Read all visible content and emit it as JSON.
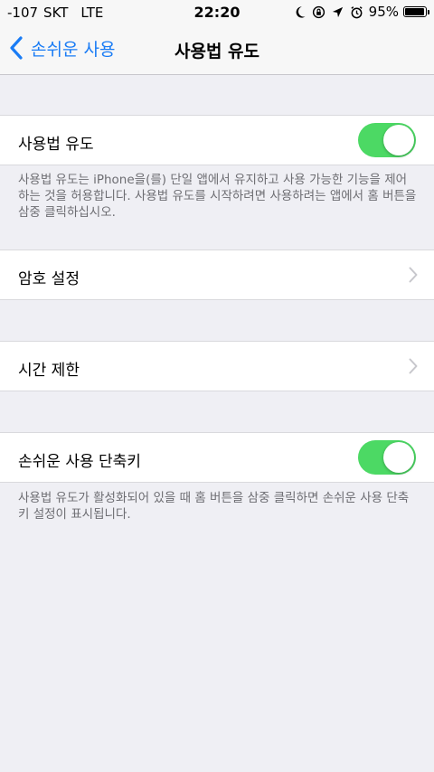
{
  "status_bar": {
    "signal": "-107",
    "carrier": "SKT",
    "network": "LTE",
    "time": "22:20",
    "battery_percent": "95%",
    "icons": [
      "moon-icon",
      "rotation-lock-icon",
      "location-arrow-icon",
      "alarm-icon",
      "battery-icon"
    ]
  },
  "nav": {
    "back_label": "손쉬운 사용",
    "title": "사용법 유도"
  },
  "sections": {
    "guided_access": {
      "label": "사용법 유도",
      "enabled": true,
      "footer": "사용법 유도는 iPhone을(를) 단일 앱에서 유지하고 사용 가능한 기능을 제어하는 것을 허용합니다. 사용법 유도를 시작하려면 사용하려는 앱에서 홈 버튼을 삼중 클릭하십시오."
    },
    "passcode": {
      "label": "암호 설정"
    },
    "time_limits": {
      "label": "시간 제한"
    },
    "shortcut": {
      "label": "손쉬운 사용 단축키",
      "enabled": true,
      "footer": "사용법 유도가 활성화되어 있을 때 홈 버튼을 삼중 클릭하면 손쉬운 사용 단축키 설정이 표시됩니다."
    }
  },
  "colors": {
    "accent": "#1a7cf5",
    "toggle_on": "#4cd964",
    "background": "#efeff4"
  }
}
